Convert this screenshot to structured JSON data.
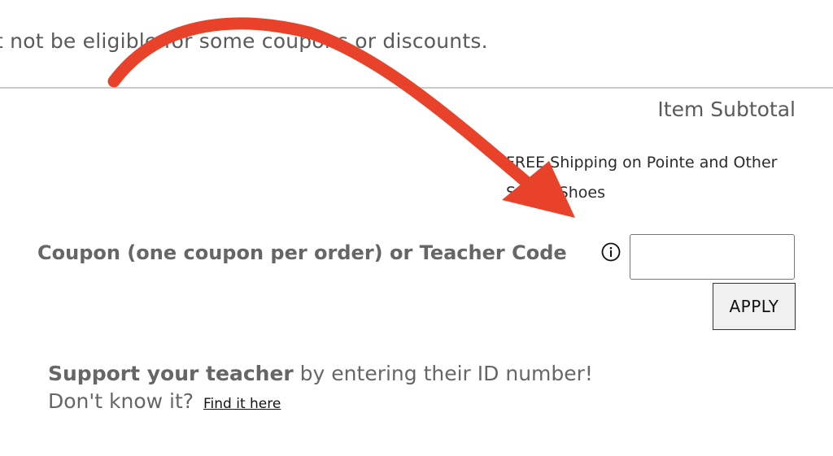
{
  "eligibility_notice": "t not be eligible for some coupons or discounts.",
  "cart": {
    "subtotal_label": "Item Subtotal",
    "shipping_note": "FREE Shipping on Pointe and Other Select Shoes"
  },
  "coupon": {
    "label": "Coupon (one coupon per order) or Teacher Code",
    "info_icon": "info-circle-icon",
    "input_value": "",
    "apply_label": "APPLY"
  },
  "support": {
    "bold_text": "Support your teacher",
    "rest_text": " by entering their ID number!",
    "question": "Don't know it?",
    "link_text": "Find it here"
  },
  "annotation": {
    "arrow_color": "#e8432a"
  },
  "colors": {
    "text_gray": "#666666",
    "divider": "#c9c9c9",
    "button_bg": "#f0f0f0"
  }
}
